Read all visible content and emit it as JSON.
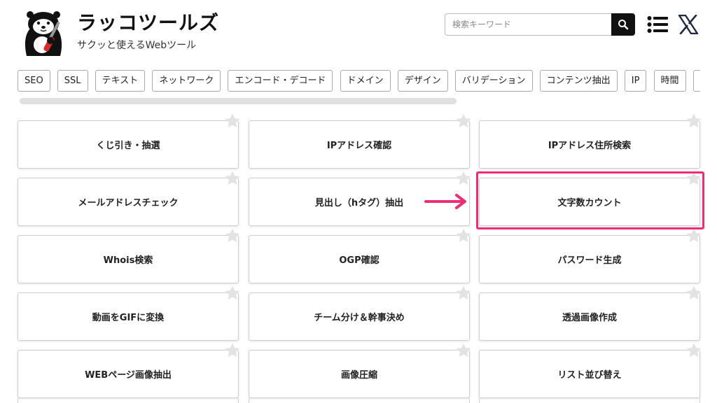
{
  "header": {
    "title": "ラッコツールズ",
    "subtitle": "サクッと使えるWebツール"
  },
  "search": {
    "placeholder": "検索キーワード"
  },
  "icons": {
    "search": "search-icon",
    "menu": "menu-icon",
    "x": "x-logo-icon",
    "star": "star-icon",
    "arrow": "arrow-right-icon"
  },
  "colors": {
    "highlight": "#ef2d74",
    "star": "#e3e3e3"
  },
  "tags": [
    "SEO",
    "SSL",
    "テキスト",
    "ネットワーク",
    "エンコード・デコード",
    "ドメイン",
    "デザイン",
    "バリデーション",
    "コンテンツ抽出",
    "IP",
    "時間",
    "C"
  ],
  "tools": [
    "くじ引き・抽選",
    "IPアドレス確認",
    "IPアドレス住所検索",
    "メールアドレスチェック",
    "見出し（hタグ）抽出",
    "文字数カウント",
    "Whois検索",
    "OGP確認",
    "パスワード生成",
    "動画をGIFに変換",
    "チーム分け＆幹事決め",
    "透過画像作成",
    "WEBページ画像抽出",
    "画像圧縮",
    "リスト並び替え"
  ]
}
